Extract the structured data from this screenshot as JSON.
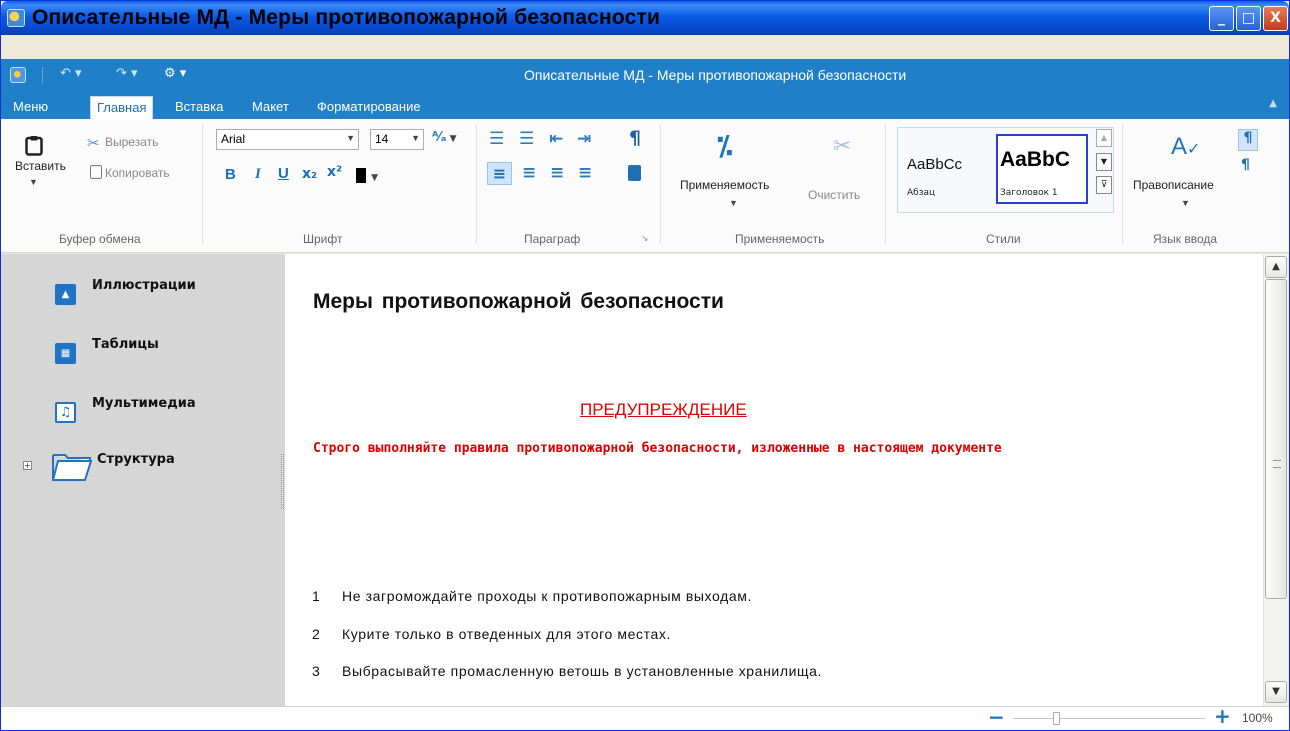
{
  "window": {
    "title": "Описательные МД - Меры противопожарной безопасности",
    "min_glyph": "_",
    "max_glyph": "□",
    "close_glyph": "X"
  },
  "qat": {
    "undo": "↶ ▾",
    "redo": "↷ ▾",
    "settings": "⚙ ▾",
    "inner_title": "Описательные МД - Меры противопожарной безопасности"
  },
  "tabs": [
    {
      "label": "Меню"
    },
    {
      "label": "Главная"
    },
    {
      "label": "Вставка"
    },
    {
      "label": "Макет"
    },
    {
      "label": "Форматирование"
    }
  ],
  "ribbon": {
    "clipboard": {
      "paste": "Вставить",
      "cut": "Вырезать",
      "copy": "Копировать",
      "group": "Буфер обмена"
    },
    "font": {
      "family": "Arial",
      "size": "14",
      "bold": "B",
      "italic": "I",
      "underline": "U",
      "subscript": "x₂",
      "superscript": "x²",
      "group": "Шрифт"
    },
    "paragraph": {
      "group": "Параграф"
    },
    "applicability": {
      "apply": "Применяемость",
      "clear": "Очистить",
      "group": "Применяемость"
    },
    "styles": {
      "sample1": "AaBbCc",
      "name1": "Абзац",
      "sample2": "AaBbC",
      "name2": "Заголовок 1",
      "group": "Стили"
    },
    "language": {
      "spelling": "Правописание",
      "group": "Язык ввода"
    }
  },
  "sidebar": {
    "items": [
      {
        "label": "Иллюстрации"
      },
      {
        "label": "Таблицы"
      },
      {
        "label": "Мультимедиа"
      },
      {
        "label": "Структура"
      }
    ]
  },
  "document": {
    "heading": "Меры противопожарной безопасности",
    "warning_title": "ПРЕДУПРЕЖДЕНИЕ",
    "warning_text": "Строго выполняйте правила противопожарной безопасности, изложенные в настоящем документе",
    "list": [
      {
        "num": "1",
        "text": "Не загромождайте проходы к противопожарным выходам."
      },
      {
        "num": "2",
        "text": "Курите только в отведенных для этого местах."
      },
      {
        "num": "3",
        "text": "Выбрасывайте промасленную ветошь в установленные хранилища."
      }
    ]
  },
  "status": {
    "zoom": "100%"
  },
  "colors": {
    "ribbon_blue": "#1f80c8",
    "warning_red": "#e00000",
    "title_blue": "#0a5be6"
  }
}
